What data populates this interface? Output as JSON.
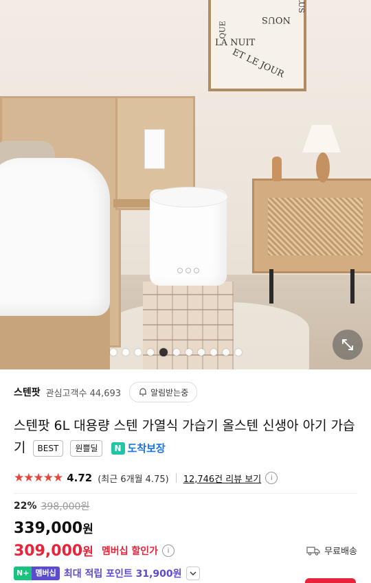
{
  "gallery": {
    "image_count": 11,
    "active_index": 4,
    "poster_text": [
      "PLUS",
      "NOUS",
      "QUE",
      "LA NUIT",
      "ET LE JOUR"
    ]
  },
  "store": {
    "name": "스텐팟",
    "watchers_label": "관심고객수 44,693",
    "notify_label": "알림받는중"
  },
  "product": {
    "title": "스텐팟 6L 대용량 스텐 가열식 가습기 올스텐 신생아 아기 가습기",
    "badge_best": "BEST",
    "badge_deal": "원쁠딜",
    "arrival_icon": "N",
    "arrival_label": "도착보장"
  },
  "rating": {
    "stars": "★★★★★",
    "value": "4.72",
    "recent": "(최근 6개월 4.75)",
    "review_link": "12,746건 리뷰 보기",
    "info_icon": "i"
  },
  "price": {
    "discount_rate": "22%",
    "original": "398,000원",
    "sale_number": "339,000",
    "sale_unit": "원",
    "member_number": "309,000",
    "member_unit": "원",
    "member_label": "멤버십 할인가",
    "info_icon": "i",
    "shipping": "무료배송"
  },
  "points": {
    "np_label": "N+",
    "membership_label": "멤버십",
    "text": "최대 적립 포인트 31,900원"
  },
  "colors": {
    "accent_red": "#e8243b",
    "star_red": "#e8443b",
    "membership_purple": "#5a4bd1",
    "naver_green": "#19c37d",
    "arrival_blue": "#1a73e8"
  }
}
